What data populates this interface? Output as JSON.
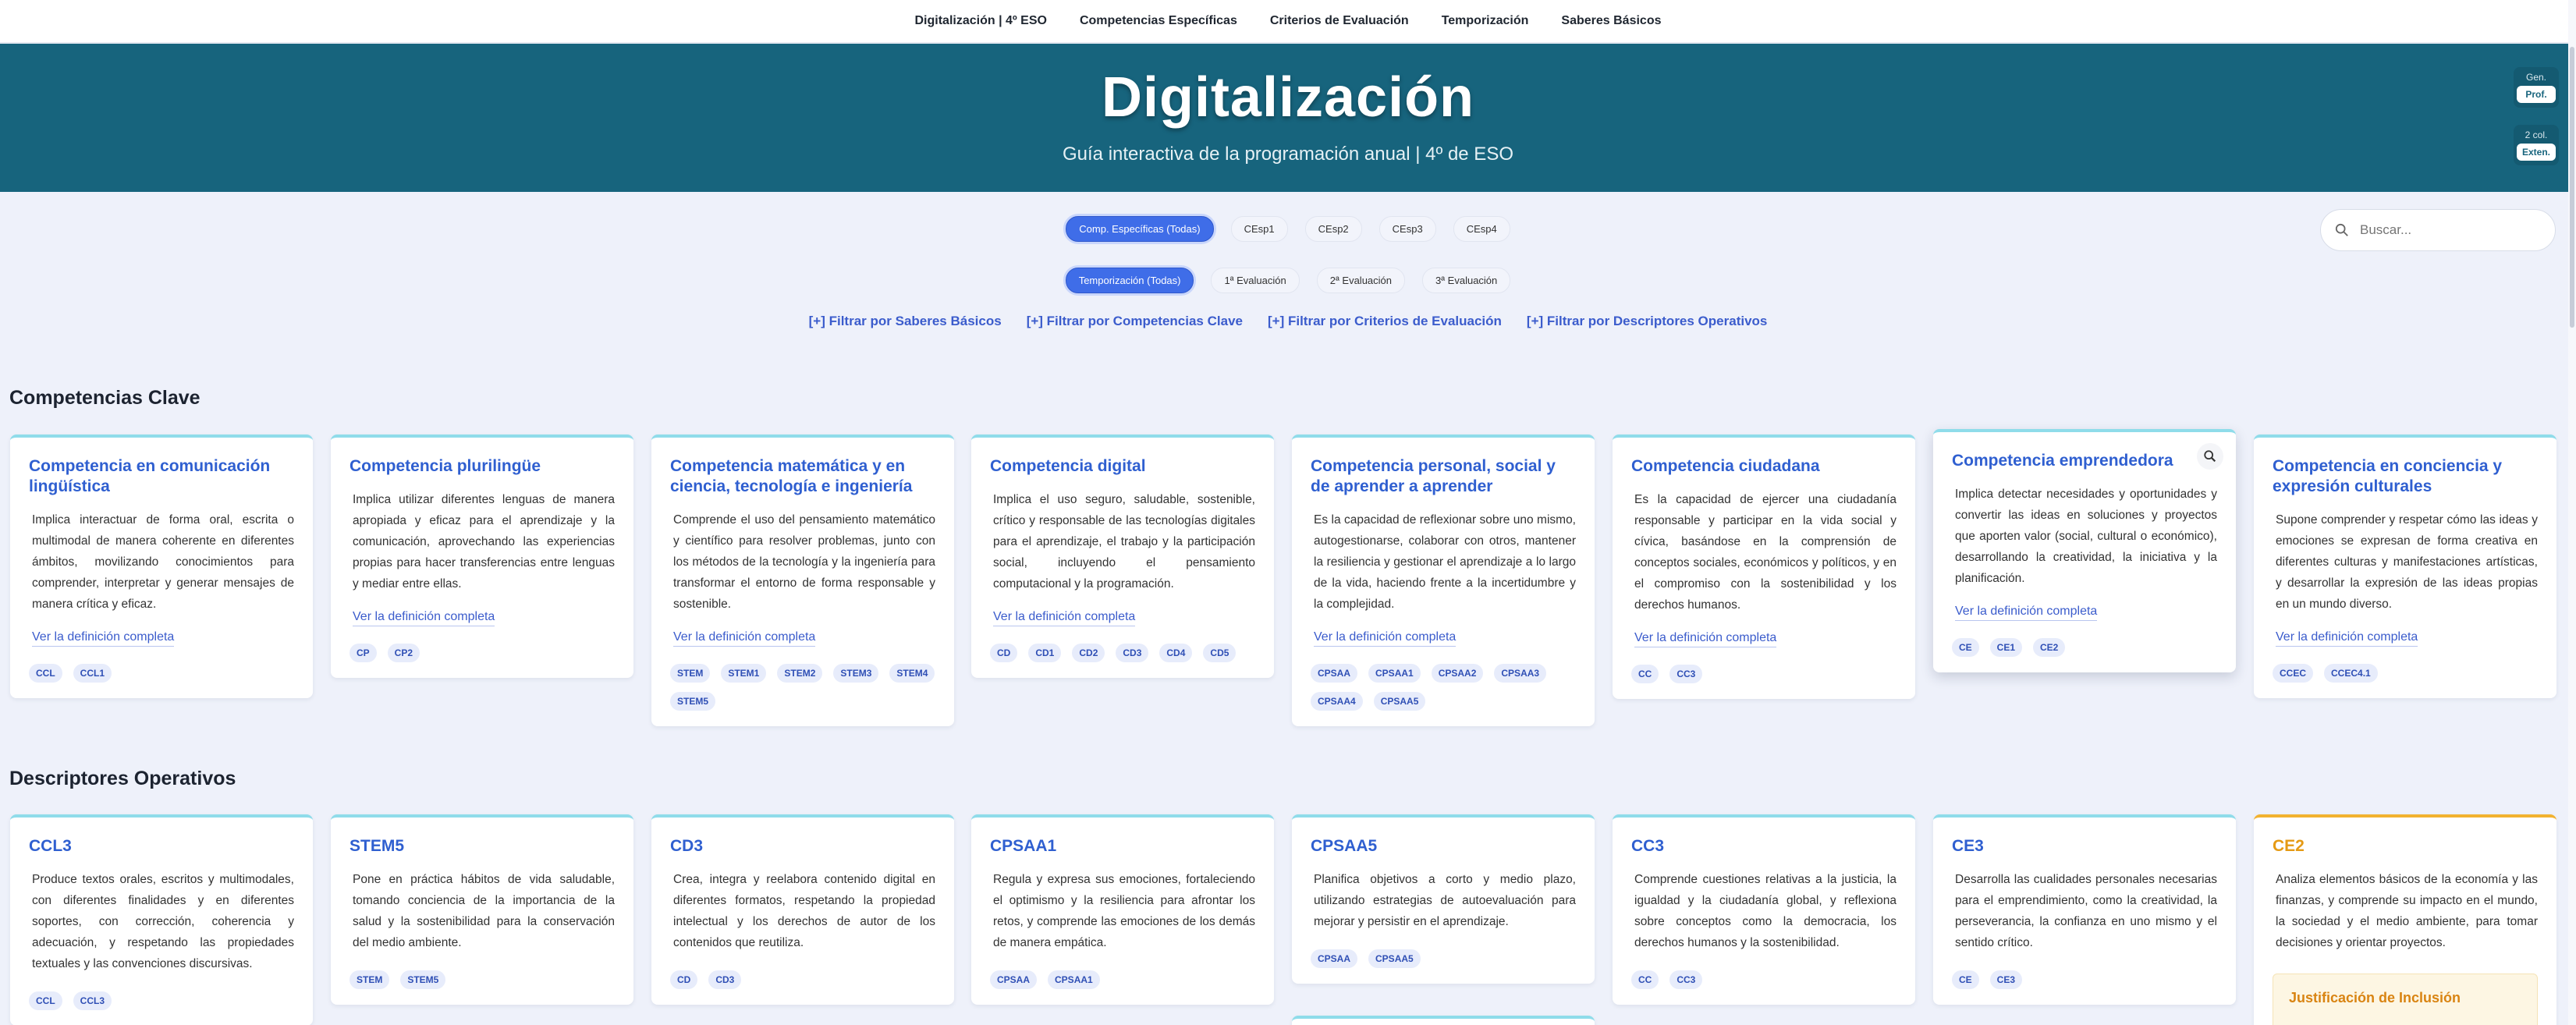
{
  "nav": {
    "items": [
      "Digitalización | 4º ESO",
      "Competencias Específicas",
      "Criterios de Evaluación",
      "Temporización",
      "Saberes Básicos"
    ]
  },
  "hero": {
    "title": "Digitalización",
    "subtitle": "Guía interactiva de la programación anual | 4º de ESO",
    "controls": [
      {
        "label": "Gen.",
        "button": "Prof."
      },
      {
        "label": "2 col.",
        "button": "Exten."
      }
    ]
  },
  "filters": {
    "competencias": [
      "Comp. Específicas (Todas)",
      "CEsp1",
      "CEsp2",
      "CEsp3",
      "CEsp4"
    ],
    "temporizacion": [
      "Temporización (Todas)",
      "1ª Evaluación",
      "2ª Evaluación",
      "3ª Evaluación"
    ],
    "links": [
      "[+] Filtrar por Saberes Básicos",
      "[+] Filtrar por Competencias Clave",
      "[+] Filtrar por Criterios de Evaluación",
      "[+] Filtrar por Descriptores Operativos"
    ]
  },
  "search": {
    "placeholder": "Buscar..."
  },
  "competencias_clave": {
    "title": "Competencias Clave",
    "more_label": "Ver la definición completa",
    "cards": [
      {
        "title": "Competencia en comunicación lingüística",
        "desc": "Implica interactuar de forma oral, escrita o multimodal de manera coherente en diferentes ámbitos, movilizando conocimientos para comprender, interpretar y generar mensajes de manera crítica y eficaz.",
        "tags": [
          "CCL",
          "CCL1"
        ]
      },
      {
        "title": "Competencia plurilingüe",
        "desc": "Implica utilizar diferentes lenguas de manera apropiada y eficaz para el aprendizaje y la comunicación, aprovechando las experiencias propias para hacer transferencias entre lenguas y mediar entre ellas.",
        "tags": [
          "CP",
          "CP2"
        ]
      },
      {
        "title": "Competencia matemática y en ciencia, tecnología e ingeniería",
        "desc": "Comprende el uso del pensamiento matemático y científico para resolver problemas, junto con los métodos de la tecnología y la ingeniería para transformar el entorno de forma responsable y sostenible.",
        "tags": [
          "STEM",
          "STEM1",
          "STEM2",
          "STEM3",
          "STEM4",
          "STEM5"
        ]
      },
      {
        "title": "Competencia digital",
        "desc": "Implica el uso seguro, saludable, sostenible, crítico y responsable de las tecnologías digitales para el aprendizaje, el trabajo y la participación social, incluyendo el pensamiento computacional y la programación.",
        "tags": [
          "CD",
          "CD1",
          "CD2",
          "CD3",
          "CD4",
          "CD5"
        ]
      },
      {
        "title": "Competencia personal, social y de aprender a aprender",
        "desc": "Es la capacidad de reflexionar sobre uno mismo, autogestionarse, colaborar con otros, mantener la resiliencia y gestionar el aprendizaje a lo largo de la vida, haciendo frente a la incertidumbre y la complejidad.",
        "tags": [
          "CPSAA",
          "CPSAA1",
          "CPSAA2",
          "CPSAA3",
          "CPSAA4",
          "CPSAA5"
        ]
      },
      {
        "title": "Competencia ciudadana",
        "desc": "Es la capacidad de ejercer una ciudadanía responsable y participar en la vida social y cívica, basándose en la comprensión de conceptos sociales, económicos y políticos, y en el compromiso con la sostenibilidad y los derechos humanos.",
        "tags": [
          "CC",
          "CC3"
        ]
      },
      {
        "title": "Competencia emprendedora",
        "desc": "Implica detectar necesidades y oportunidades y convertir las ideas en soluciones y proyectos que aporten valor (social, cultural o económico), desarrollando la creatividad, la iniciativa y la planificación.",
        "tags": [
          "CE",
          "CE1",
          "CE2"
        ]
      },
      {
        "title": "Competencia en conciencia y expresión culturales",
        "desc": "Supone comprender y respetar cómo las ideas y emociones se expresan de forma creativa en diferentes culturas y manifestaciones artísticas, y desarrollar la expresión de las ideas propias en un mundo diverso.",
        "tags": [
          "CCEC",
          "CCEC4.1"
        ]
      }
    ]
  },
  "descriptores": {
    "title": "Descriptores Operativos",
    "justif_label": "Justificación de Inclusión",
    "cards": [
      {
        "title": "CCL3",
        "desc": "Produce textos orales, escritos y multimodales, con diferentes finalidades y en diferentes soportes, con corrección, coherencia y adecuación, y respetando las propiedades textuales y las convenciones discursivas.",
        "tags": [
          "CCL",
          "CCL3"
        ]
      },
      {
        "title": "STEM5",
        "desc": "Pone en práctica hábitos de vida saludable, tomando conciencia de la importancia de la salud y la sostenibilidad para la conservación del medio ambiente.",
        "tags": [
          "STEM",
          "STEM5"
        ]
      },
      {
        "title": "CD3",
        "desc": "Crea, integra y reelabora contenido digital en diferentes formatos, respetando la propiedad intelectual y los derechos de autor de los contenidos que reutiliza.",
        "tags": [
          "CD",
          "CD3"
        ]
      },
      {
        "title": "CPSAA1",
        "desc": "Regula y expresa sus emociones, fortaleciendo el optimismo y la resiliencia para afrontar los retos, y comprende las emociones de los demás de manera empática.",
        "tags": [
          "CPSAA",
          "CPSAA1"
        ]
      },
      {
        "title": "CPSAA5",
        "desc": "Planifica objetivos a corto y medio plazo, utilizando estrategias de autoevaluación para mejorar y persistir en el aprendizaje.",
        "tags": [
          "CPSAA",
          "CPSAA5"
        ]
      },
      {
        "title": "CC3",
        "desc": "Comprende cuestiones relativas a la justicia, la igualdad y la ciudadanía global, y reflexiona sobre conceptos como la democracia, los derechos humanos y la sostenibilidad.",
        "tags": [
          "CC",
          "CC3"
        ]
      },
      {
        "title": "CE3",
        "desc": "Desarrolla las cualidades personales necesarias para el emprendimiento, como la creatividad, la perseverancia, la confianza en uno mismo y el sentido crítico.",
        "tags": [
          "CE",
          "CE3"
        ]
      },
      {
        "title": "CE2",
        "desc": "Analiza elementos básicos de la economía y las finanzas, y comprende su impacto en el mundo, la sociedad y el medio ambiente, para tomar decisiones y orientar proyectos.",
        "tags": []
      }
    ]
  }
}
